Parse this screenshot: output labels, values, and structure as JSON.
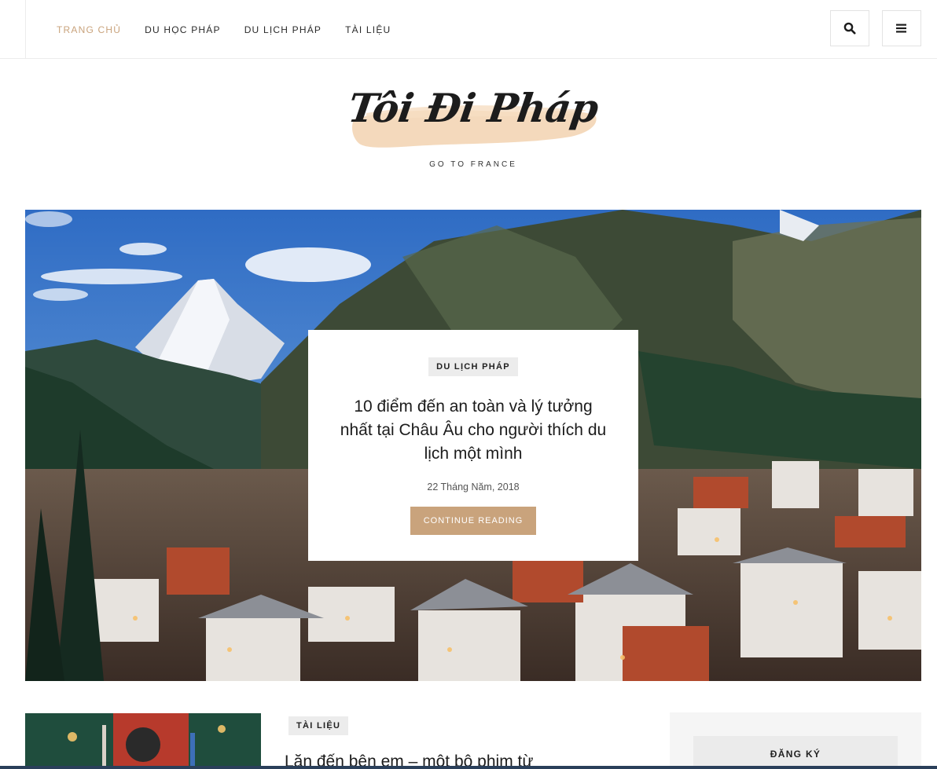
{
  "nav": {
    "items": [
      {
        "label": "TRANG CHỦ",
        "active": true
      },
      {
        "label": "DU HỌC PHÁP",
        "active": false
      },
      {
        "label": "DU LỊCH PHÁP",
        "active": false
      },
      {
        "label": "TÀI LIỆU",
        "active": false
      }
    ],
    "search_icon": "search-icon",
    "menu_icon": "hamburger-icon"
  },
  "logo": {
    "text": "Tôi Đi Pháp",
    "tagline": "GO TO FRANCE"
  },
  "hero": {
    "category": "DU LỊCH PHÁP",
    "title": "10 điểm đến an toàn và lý tưởng nhất tại Châu Âu cho người thích du lịch một mình",
    "date": "22 Tháng Năm, 2018",
    "cta": "CONTINUE READING"
  },
  "post": {
    "category": "TÀI LIỆU",
    "title": "Lăn đến bên em – một bộ phim từ"
  },
  "sidebar": {
    "heading": "ĐĂNG KÝ"
  },
  "colors": {
    "accent": "#c9a37c",
    "tag_bg": "#ececec",
    "text": "#222222"
  }
}
